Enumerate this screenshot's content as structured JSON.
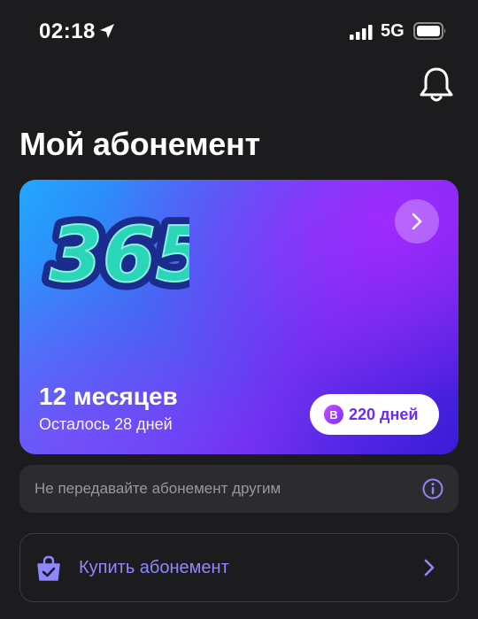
{
  "status_bar": {
    "time": "02:18",
    "network": "5G",
    "icons": [
      "location-arrow-icon",
      "signal-bars-icon",
      "battery-icon"
    ]
  },
  "header": {
    "bell_icon": "bell-icon",
    "title": "Мой абонемент"
  },
  "subscription_card": {
    "logo_text": "365",
    "period": "12 месяцев",
    "remaining": "Осталось 28 дней",
    "bonus": {
      "coin_letter": "B",
      "label": "220 дней"
    },
    "arrow_icon": "chevron-right-icon",
    "colors": {
      "gradient_start": "#22a7ff",
      "gradient_mid": "#6a2ff0",
      "gradient_end": "#3a1cd6",
      "logo_fill": "#2bd6b8",
      "logo_outline": "#1b2c8f"
    }
  },
  "notice": {
    "text": "Не передавайте абонемент другим",
    "icon": "info-icon"
  },
  "buy_button": {
    "label": "Купить абонемент",
    "icon": "shopping-bag-icon",
    "chevron_icon": "chevron-right-icon",
    "accent_color": "#8e87ff"
  }
}
